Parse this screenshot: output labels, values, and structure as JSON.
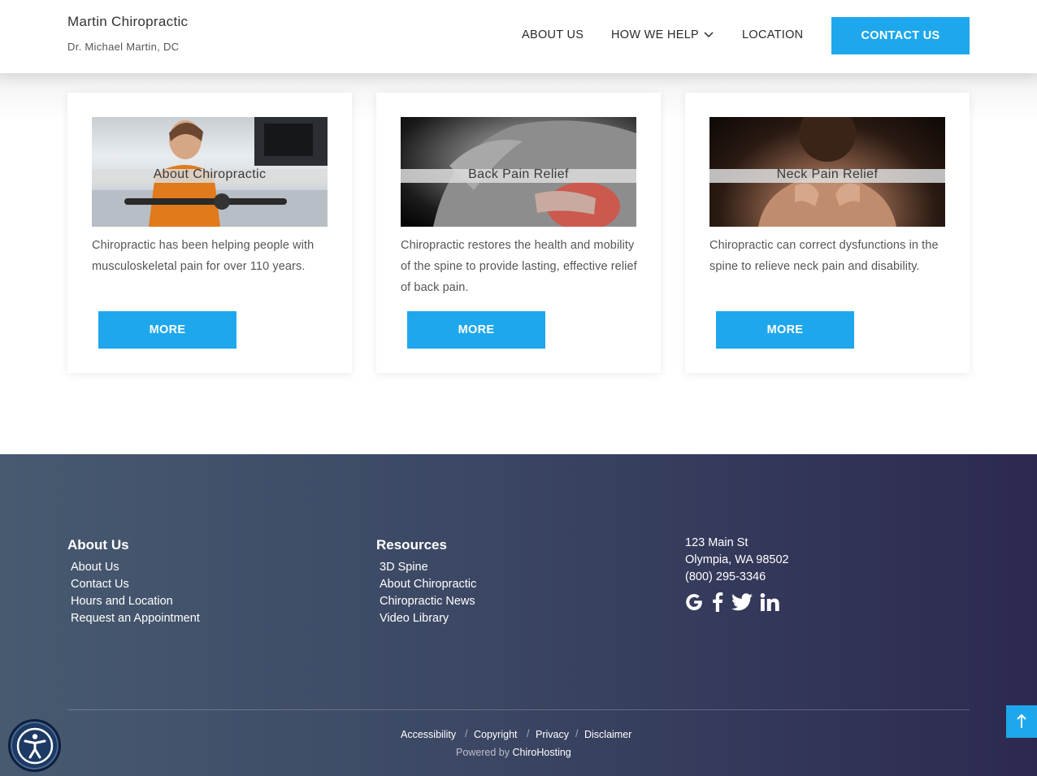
{
  "header": {
    "brand_title": "Martin Chiropractic",
    "brand_subtitle": "Dr. Michael Martin, DC",
    "nav": {
      "about": "ABOUT US",
      "help": "HOW WE HELP",
      "location": "LOCATION"
    },
    "contact_label": "CONTACT US"
  },
  "cards": [
    {
      "image_label": "About Chiropractic",
      "text": "Chiropractic has been helping people with musculoskeletal pain for over 110 years.",
      "button": "MORE"
    },
    {
      "image_label": "Back Pain Relief",
      "text": "Chiropractic restores the health and mobility of the spine to provide lasting, effective relief of back pain.",
      "button": "MORE"
    },
    {
      "image_label": "Neck Pain Relief",
      "text": "Chiropractic can correct dysfunctions in the spine to relieve neck pain and disability.",
      "button": "MORE"
    }
  ],
  "footer": {
    "about": {
      "title": "About Us",
      "links": [
        "About Us",
        "Contact Us",
        "Hours and Location",
        "Request an Appointment"
      ]
    },
    "resources": {
      "title": "Resources",
      "links": [
        "3D Spine",
        "About Chiropractic",
        "Chiropractic News",
        "Video Library"
      ]
    },
    "address": {
      "street": "123 Main St",
      "city": "Olympia, WA  98502",
      "phone": "(800) 295-3346"
    },
    "social_icons": [
      "google-icon",
      "facebook-icon",
      "twitter-icon",
      "linkedin-icon"
    ],
    "legal": [
      "Accessibility",
      "Copyright",
      "Privacy",
      "Disclaimer"
    ],
    "separator": "/",
    "powered_prefix": "Powered by",
    "powered_brand": "ChiroHosting"
  },
  "colors": {
    "accent": "#1ea7ec",
    "footer_start": "#475a70",
    "footer_end": "#2c2950"
  }
}
